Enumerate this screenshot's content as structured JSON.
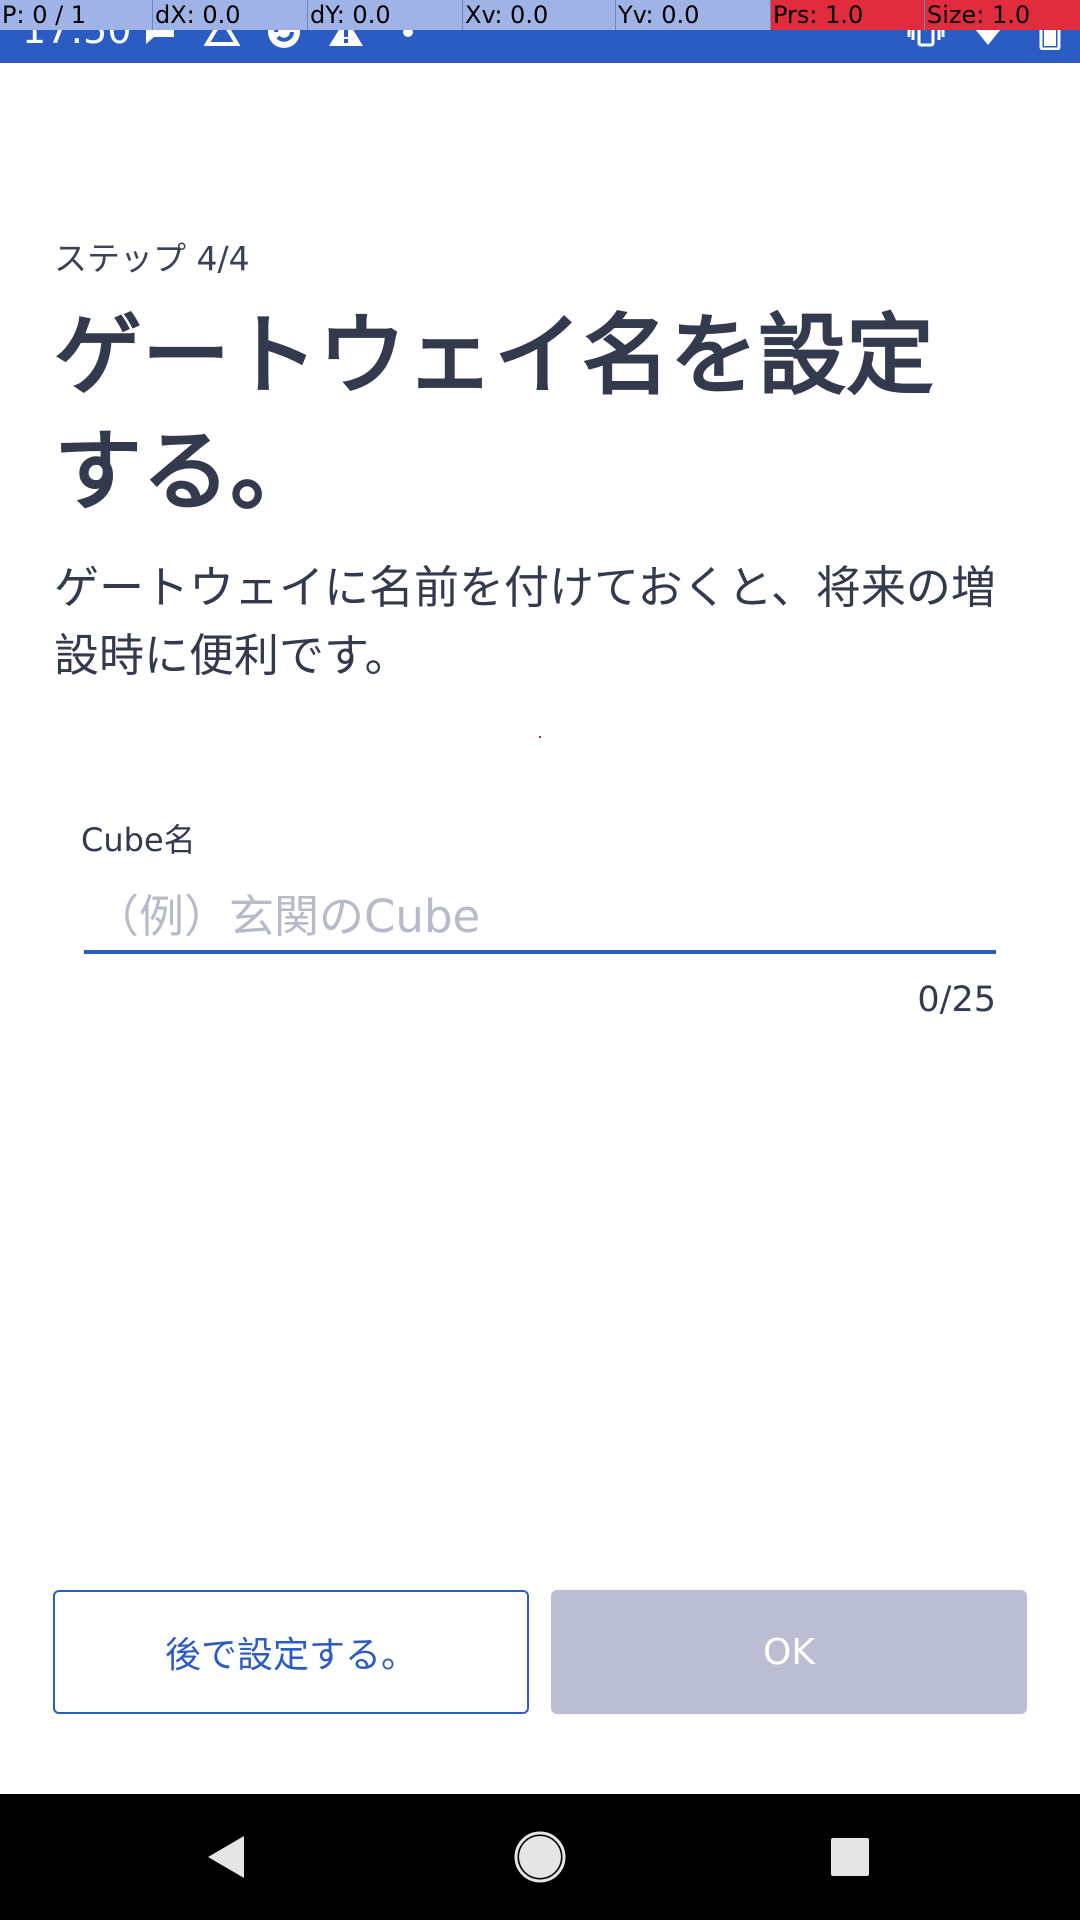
{
  "status_bar": {
    "time": "17:50",
    "left_icons": [
      "chat-icon",
      "drive-icon",
      "sync-icon",
      "warning-icon",
      "more-dot-icon"
    ],
    "right_icons": [
      "vibrate-icon",
      "wifi-icon",
      "battery-icon"
    ],
    "background_color": "#2b5cc4"
  },
  "debug_overlay": {
    "cells": [
      {
        "text": "P: 0 / 1",
        "color": "#9fb3e6"
      },
      {
        "text": "dX: 0.0",
        "color": "#9fb3e6"
      },
      {
        "text": "dY: 0.0",
        "color": "#9fb3e6"
      },
      {
        "text": "Xv: 0.0",
        "color": "#9fb3e6"
      },
      {
        "text": "Yv: 0.0",
        "color": "#9fb3e6"
      },
      {
        "text": "Prs: 1.0",
        "color": "#e02c3c"
      },
      {
        "text": "Size: 1.0",
        "color": "#e02c3c"
      }
    ]
  },
  "setup": {
    "step_label": "ステップ 4/4",
    "title": "ゲートウェイ名を設定する。",
    "description": "ゲートウェイに名前を付けておくと、将来の増設時に便利です。"
  },
  "name_field": {
    "label": "Cube名",
    "value": "",
    "placeholder": "（例）玄関のCube",
    "counter": "0/25",
    "accent_color": "#2b5cc4"
  },
  "buttons": {
    "later_label": "後で設定する。",
    "ok_label": "OK",
    "ok_enabled": false,
    "ok_disabled_color": "#bbbdd2"
  },
  "navigation": {
    "icons": [
      "back-icon",
      "home-icon",
      "recents-icon"
    ]
  }
}
